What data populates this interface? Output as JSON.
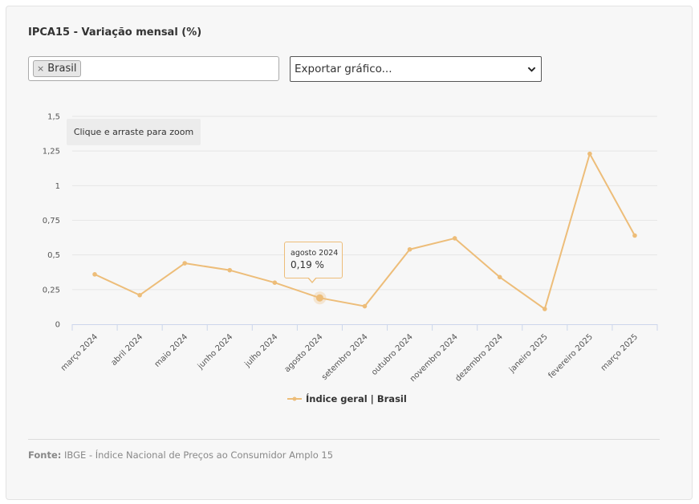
{
  "header": {
    "title": "IPCA15 - Variação mensal (%)"
  },
  "filter": {
    "chip_remove": "×",
    "chip_label": "Brasil"
  },
  "export": {
    "label": "Exportar gráfico..."
  },
  "zoom_hint": "Clique e arraste para zoom",
  "tooltip": {
    "date": "agosto 2024",
    "value": "0,19 %"
  },
  "footer": {
    "source_label": "Fonte:",
    "source_text": "IBGE - Índice Nacional de Preços ao Consumidor Amplo 15"
  },
  "colors": {
    "series": "#edbd79",
    "grid": "#e6e6e6",
    "axis": "#ccd6eb"
  },
  "chart_data": {
    "type": "line",
    "title": "IPCA15 - Variação mensal (%)",
    "xlabel": "",
    "ylabel": "",
    "categories": [
      "março 2024",
      "abril 2024",
      "maio 2024",
      "junho 2024",
      "julho 2024",
      "agosto 2024",
      "setembro 2024",
      "outubro 2024",
      "novembro 2024",
      "dezembro 2024",
      "janeiro 2025",
      "fevereiro 2025",
      "março 2025"
    ],
    "series": [
      {
        "name": "Índice geral | Brasil",
        "values": [
          0.36,
          0.21,
          0.44,
          0.39,
          0.3,
          0.19,
          0.13,
          0.54,
          0.62,
          0.34,
          0.11,
          1.23,
          0.64
        ]
      }
    ],
    "yticks": [
      "0",
      "0,25",
      "0,5",
      "0,75",
      "1",
      "1,25",
      "1,5"
    ],
    "ylim": [
      0,
      1.5
    ],
    "grid": true,
    "legend": "bottom-center",
    "highlight_index": 5
  }
}
